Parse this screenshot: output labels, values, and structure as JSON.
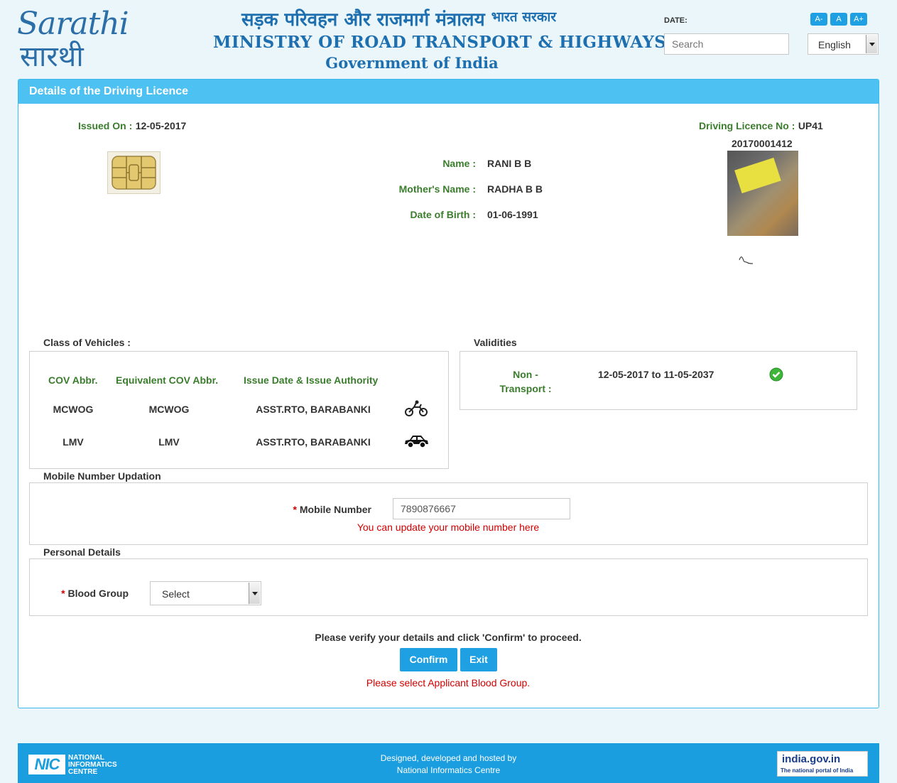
{
  "header": {
    "logo_en": "Sarathi",
    "logo_hi": "सारथी",
    "ministry_hi": "सड़क परिवहन और राजमार्ग मंत्रालय",
    "ministry_hi_small": "भारत सरकार",
    "ministry_en": "MINISTRY OF ROAD TRANSPORT & HIGHWAYS",
    "government": "Government of India",
    "date_label": "DATE:",
    "search_placeholder": "Search",
    "font_buttons": [
      "A-",
      "A",
      "A+"
    ],
    "language": "English"
  },
  "panel": {
    "title": "Details of the Driving Licence",
    "issued_on_label": "Issued On :",
    "issued_on": "12-05-2017",
    "dl_no_label": "Driving Licence No :",
    "dl_no_prefix": "UP41",
    "dl_no_rest": "20170001412",
    "name_label": "Name :",
    "name": "RANI B B",
    "mother_label": "Mother's Name :",
    "mother": "RADHA B B",
    "dob_label": "Date of Birth :",
    "dob": "01-06-1991"
  },
  "vehicles": {
    "legend": "Class of Vehicles :",
    "headers": [
      "COV Abbr.",
      "Equivalent COV Abbr.",
      "Issue Date & Issue Authority"
    ],
    "rows": [
      {
        "cov": "MCWOG",
        "equiv": "MCWOG",
        "authority": "ASST.RTO, BARABANKI",
        "icon": "motorcycle-icon"
      },
      {
        "cov": "LMV",
        "equiv": "LMV",
        "authority": "ASST.RTO, BARABANKI",
        "icon": "car-icon"
      }
    ]
  },
  "validities": {
    "legend": "Validities",
    "label_line1": "Non -",
    "label_line2": "Transport :",
    "range": "12-05-2017 to 11-05-2037",
    "status_icon": "check-circle-icon"
  },
  "mobile": {
    "legend": "Mobile Number Updation",
    "star": "*",
    "label": "Mobile Number",
    "value": "7890876667",
    "hint": "You can update your mobile number here"
  },
  "personal": {
    "legend": "Personal Details",
    "star": "*",
    "label": "Blood Group",
    "selected": "Select"
  },
  "actions": {
    "prompt": "Please verify your details and click 'Confirm' to proceed.",
    "confirm": "Confirm",
    "exit": "Exit",
    "error": "Please select Applicant Blood Group."
  },
  "footer": {
    "nic_logo": "NIC",
    "nic_text": [
      "NATIONAL",
      "INFORMATICS",
      "CENTRE"
    ],
    "line1": "Designed, developed and hosted by",
    "line2": "National Informatics Centre",
    "indiagov_a": "india.gov.in",
    "indiagov_b": "The national portal of India"
  },
  "colors": {
    "accent": "#1fa0e3",
    "panel_header": "#4ec1f3",
    "label_green": "#3a7d2c",
    "error_red": "#d20000"
  }
}
